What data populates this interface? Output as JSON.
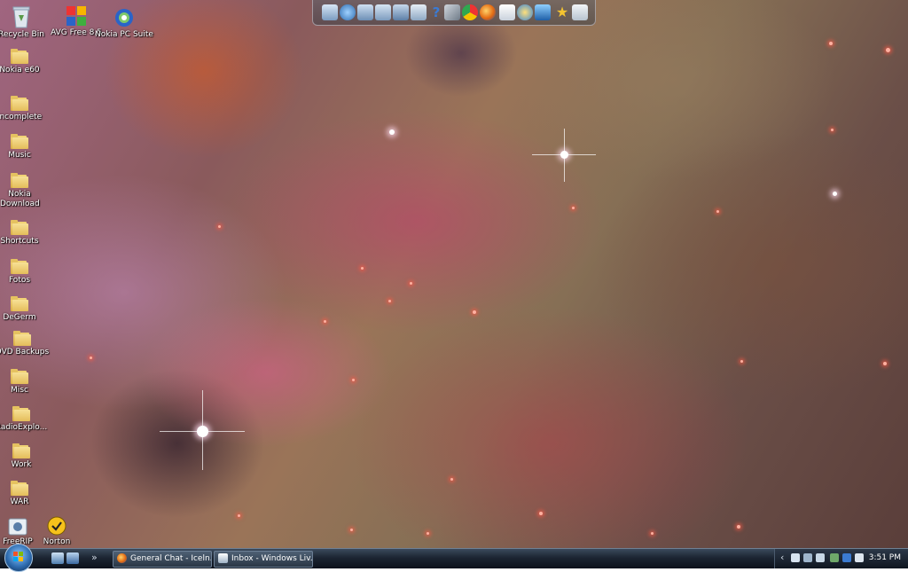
{
  "desktop_icons": [
    {
      "id": "recycle-bin",
      "label": "Recycle Bin",
      "kind": "recycle"
    },
    {
      "id": "avg",
      "label": "AVG Free 8.5",
      "kind": "avg"
    },
    {
      "id": "nokia-pc-suite",
      "label": "Nokia PC Suite",
      "kind": "nokia"
    },
    {
      "id": "nokia-e60",
      "label": "Nokia e60",
      "kind": "folder"
    },
    {
      "id": "incomplete",
      "label": "Incomplete",
      "kind": "folder"
    },
    {
      "id": "music",
      "label": "Music",
      "kind": "folder"
    },
    {
      "id": "nokia-download",
      "label": "Nokia Download",
      "kind": "folder"
    },
    {
      "id": "shortcuts",
      "label": "Shortcuts",
      "kind": "folder"
    },
    {
      "id": "fotos",
      "label": "Fotos",
      "kind": "folder"
    },
    {
      "id": "degerm",
      "label": "DeGerm",
      "kind": "folder"
    },
    {
      "id": "dvd-backups",
      "label": "DVD Backups",
      "kind": "folder"
    },
    {
      "id": "misc",
      "label": "Misc",
      "kind": "folder"
    },
    {
      "id": "radioexplorer",
      "label": "RadioExplo...",
      "kind": "folder"
    },
    {
      "id": "work",
      "label": "Work",
      "kind": "folder"
    },
    {
      "id": "war",
      "label": "WAR",
      "kind": "folder"
    },
    {
      "id": "freerip",
      "label": "FreeRIP",
      "kind": "freerip"
    },
    {
      "id": "norton",
      "label": "Norton",
      "kind": "norton"
    }
  ],
  "dock_icons": [
    "computer-icon",
    "network-icon",
    "documents-icon",
    "folder-icon",
    "pictures-icon",
    "drive-icon",
    "help-icon",
    "tools-icon",
    "chrome-icon",
    "firefox-icon",
    "mail-icon",
    "connect-icon",
    "monitor-icon",
    "star-icon",
    "recycle-bin-icon"
  ],
  "taskbar": {
    "quick_launch": [
      "show-desktop-icon",
      "switch-windows-icon"
    ],
    "overflow": "»",
    "tasks": [
      {
        "label": "General Chat - Iceln...",
        "icon": "firefox-icon"
      },
      {
        "label": "Inbox - Windows Liv...",
        "icon": "mail-icon"
      }
    ],
    "tray": {
      "expand": "‹",
      "icons": [
        "tray-network-icon",
        "tray-volume-icon",
        "tray-security-icon",
        "tray-sync-icon",
        "tray-antivirus-icon",
        "tray-speaker-icon"
      ],
      "time": "3:51 PM"
    }
  },
  "colors": {
    "taskbar": "#1c2532",
    "folder": "#e4bd5a",
    "start": "#2f6db0"
  }
}
